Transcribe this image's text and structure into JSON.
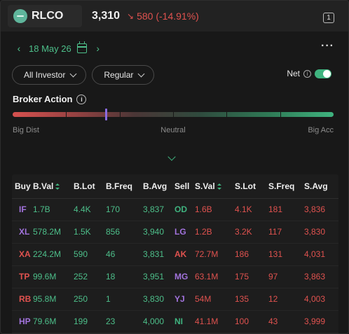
{
  "header": {
    "ticker": "RLCO",
    "price": "3,310",
    "change_arrow": "↘",
    "change": "580 (-14.91%)",
    "window_count": "1"
  },
  "date_nav": {
    "prev_icon": "chevron-left-icon",
    "date": "18 May 26",
    "next_icon": "chevron-right-icon",
    "more_icon": "more-horizontal-icon"
  },
  "filters": {
    "investor": "All Investor",
    "market": "Regular",
    "net_label": "Net",
    "net_enabled": true
  },
  "broker_action": {
    "title": "Broker Action",
    "level": 0.29,
    "labels": {
      "left": "Big Dist",
      "mid": "Neutral",
      "right": "Big Acc"
    },
    "colors": {
      "dist": "#d6514f",
      "acc": "#3fb37f",
      "marker": "#8a6be0"
    }
  },
  "table": {
    "headers": [
      "Buy",
      "B.Val",
      "B.Lot",
      "B.Freq",
      "B.Avg",
      "Sell",
      "S.Val",
      "S.Lot",
      "S.Freq",
      "S.Avg"
    ],
    "rows": [
      {
        "buy": "IF",
        "buy_color": "purple",
        "bval": "1.7B",
        "blot": "4.4K",
        "bfreq": "170",
        "bavg": "3,837",
        "sell": "OD",
        "sell_color": "green",
        "sval": "1.6B",
        "slot": "4.1K",
        "sfreq": "181",
        "savg": "3,836"
      },
      {
        "buy": "XL",
        "buy_color": "purple",
        "bval": "578.2M",
        "blot": "1.5K",
        "bfreq": "856",
        "bavg": "3,940",
        "sell": "LG",
        "sell_color": "purple",
        "sval": "1.2B",
        "slot": "3.2K",
        "sfreq": "117",
        "savg": "3,830"
      },
      {
        "buy": "XA",
        "buy_color": "red",
        "bval": "224.2M",
        "blot": "590",
        "bfreq": "46",
        "bavg": "3,831",
        "sell": "AK",
        "sell_color": "red",
        "sval": "72.7M",
        "slot": "186",
        "sfreq": "131",
        "savg": "4,031"
      },
      {
        "buy": "TP",
        "buy_color": "red",
        "bval": "99.6M",
        "blot": "252",
        "bfreq": "18",
        "bavg": "3,951",
        "sell": "MG",
        "sell_color": "purple",
        "sval": "63.1M",
        "slot": "175",
        "sfreq": "97",
        "savg": "3,863"
      },
      {
        "buy": "RB",
        "buy_color": "red",
        "bval": "95.8M",
        "blot": "250",
        "bfreq": "1",
        "bavg": "3,830",
        "sell": "YJ",
        "sell_color": "purple",
        "sval": "54M",
        "slot": "135",
        "sfreq": "12",
        "savg": "4,003"
      },
      {
        "buy": "HP",
        "buy_color": "purple",
        "bval": "79.6M",
        "blot": "199",
        "bfreq": "23",
        "bavg": "4,000",
        "sell": "NI",
        "sell_color": "green",
        "sval": "41.1M",
        "slot": "100",
        "sfreq": "43",
        "savg": "3,999"
      }
    ]
  }
}
